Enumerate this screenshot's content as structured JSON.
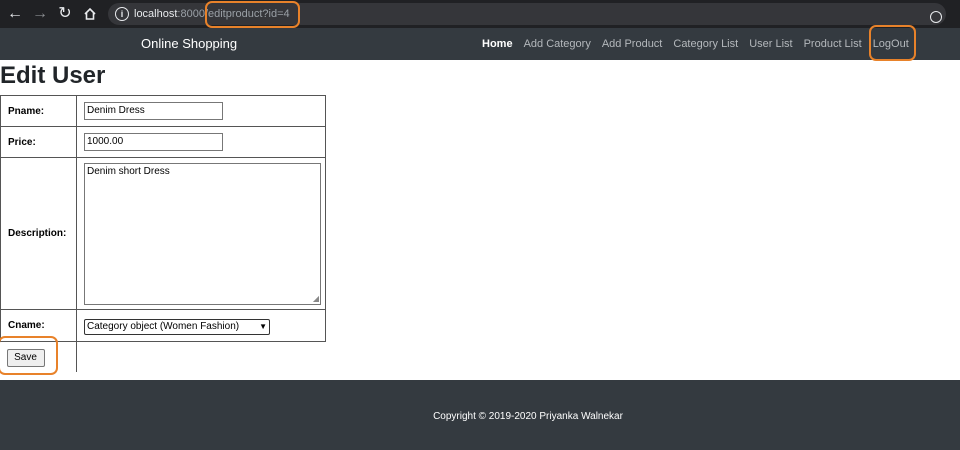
{
  "browser": {
    "back_icon": "arrow-left-icon",
    "forward_icon": "arrow-right-icon",
    "reload_icon": "reload-icon",
    "home_icon": "home-icon",
    "info_icon": "info-icon",
    "url_host": "localhost",
    "url_rest": ":8000/editproduct?id=4",
    "highlight_color": "#e8822a"
  },
  "navbar": {
    "brand": "Online Shopping",
    "links": [
      "Home",
      "Add Category",
      "Add Product",
      "Category List",
      "User List",
      "Product List",
      "LogOut"
    ],
    "active": "Home"
  },
  "page": {
    "title": "Edit User"
  },
  "form": {
    "pname_label": "Pname:",
    "pname_value": "Denim Dress",
    "price_label": "Price:",
    "price_value": "1000.00",
    "description_label": "Description:",
    "description_value": "Denim short Dress",
    "cname_label": "Cname:",
    "cname_selected": "Category object (Women Fashion)",
    "save_label": "Save"
  },
  "footer": {
    "copyright": "Copyright © 2019-2020 Priyanka Walnekar"
  }
}
